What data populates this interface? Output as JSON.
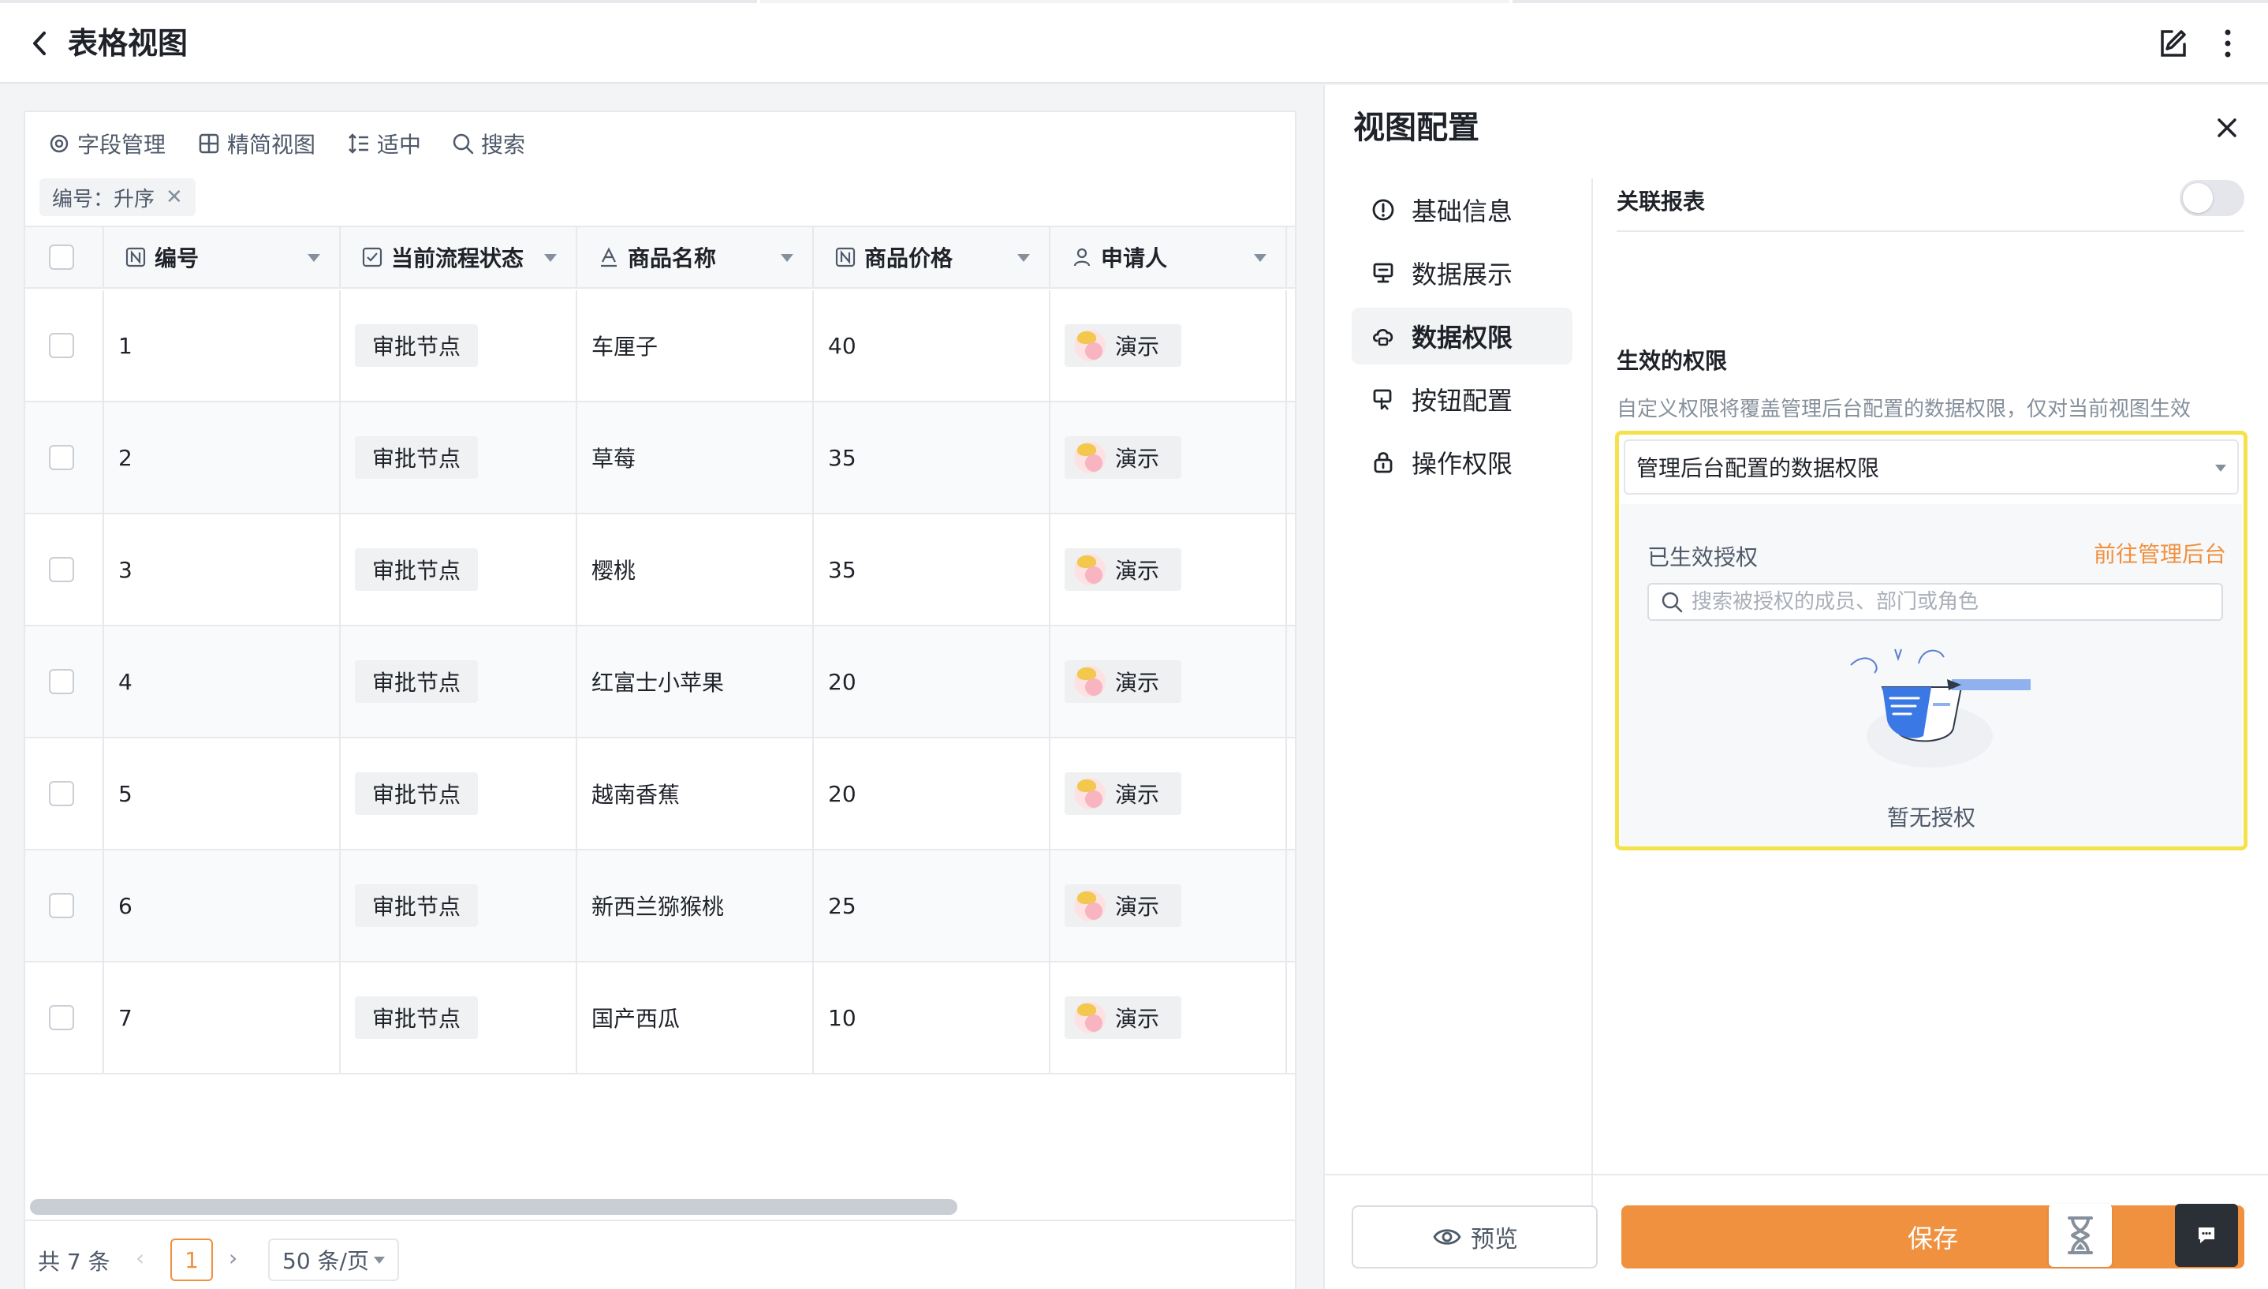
{
  "header": {
    "title": "表格视图",
    "back_icon": "chevron-left-icon",
    "edit_icon": "edit-icon",
    "more_icon": "more-vertical-icon"
  },
  "toolbar": {
    "items": [
      {
        "label": "字段管理",
        "icon": "gear-icon"
      },
      {
        "label": "精简视图",
        "icon": "grid-icon"
      },
      {
        "label": "适中",
        "icon": "row-height-icon"
      },
      {
        "label": "搜索",
        "icon": "search-icon"
      }
    ],
    "filter_tag": "编号：升序"
  },
  "table": {
    "columns": [
      {
        "label": "编号",
        "icon": "number-field-icon"
      },
      {
        "label": "当前流程状态",
        "icon": "checkbox-field-icon"
      },
      {
        "label": "商品名称",
        "icon": "text-field-icon"
      },
      {
        "label": "商品价格",
        "icon": "number-field-icon"
      },
      {
        "label": "申请人",
        "icon": "user-field-icon"
      }
    ],
    "rows": [
      {
        "id": "1",
        "status": "审批节点",
        "name": "车厘子",
        "price": "40",
        "applicant": "演示"
      },
      {
        "id": "2",
        "status": "审批节点",
        "name": "草莓",
        "price": "35",
        "applicant": "演示"
      },
      {
        "id": "3",
        "status": "审批节点",
        "name": "樱桃",
        "price": "35",
        "applicant": "演示"
      },
      {
        "id": "4",
        "status": "审批节点",
        "name": "红富士小苹果",
        "price": "20",
        "applicant": "演示"
      },
      {
        "id": "5",
        "status": "审批节点",
        "name": "越南香蕉",
        "price": "20",
        "applicant": "演示"
      },
      {
        "id": "6",
        "status": "审批节点",
        "name": "新西兰猕猴桃",
        "price": "25",
        "applicant": "演示"
      },
      {
        "id": "7",
        "status": "审批节点",
        "name": "国产西瓜",
        "price": "10",
        "applicant": "演示"
      }
    ]
  },
  "pagination": {
    "total": "共 7 条",
    "current": "1",
    "page_size": "50 条/页",
    "prev": "‹",
    "next": "›"
  },
  "config": {
    "title": "视图配置",
    "menu": [
      {
        "label": "基础信息",
        "icon": "info-icon"
      },
      {
        "label": "数据展示",
        "icon": "display-icon"
      },
      {
        "label": "数据权限",
        "icon": "data-permission-icon",
        "active": true
      },
      {
        "label": "按钮配置",
        "icon": "button-config-icon"
      },
      {
        "label": "操作权限",
        "icon": "lock-icon"
      }
    ],
    "link_report_label": "关联报表",
    "permission_title": "生效的权限",
    "permission_desc": "自定义权限将覆盖管理后台配置的数据权限，仅对当前视图生效",
    "permission_select": "管理后台配置的数据权限",
    "granted_title": "已生效授权",
    "go_admin": "前往管理后台",
    "search_placeholder": "搜索被授权的成员、部门或角色",
    "empty_text": "暂无授权",
    "preview_label": "预览",
    "save_label": "保存"
  },
  "colors": {
    "accent": "#f0913f",
    "highlight": "#f5e24a"
  }
}
